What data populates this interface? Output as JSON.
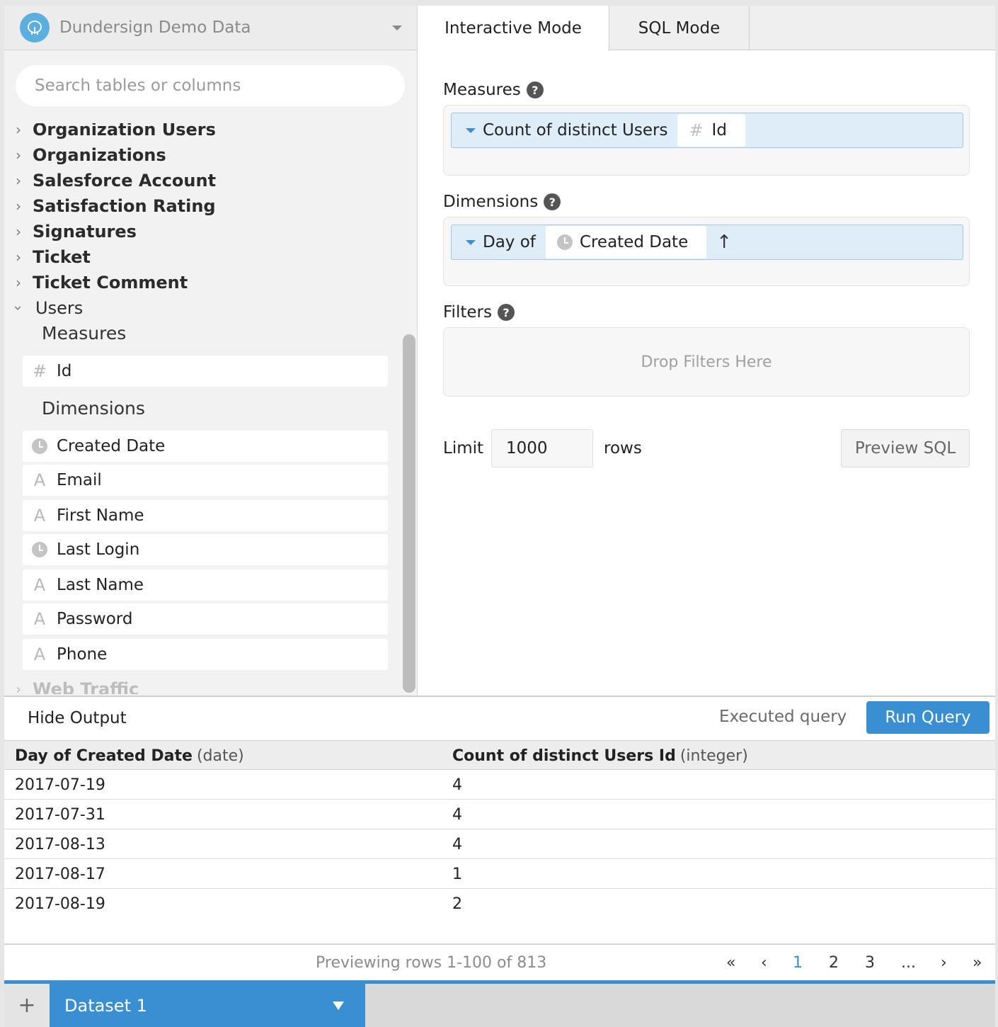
{
  "sidebar": {
    "database": "Dundersign Demo Data",
    "search_placeholder": "Search tables or columns",
    "tables": [
      "Organization Users",
      "Organizations",
      "Salesforce Account",
      "Satisfaction Rating",
      "Signatures",
      "Ticket",
      "Ticket Comment"
    ],
    "open_table": "Users",
    "measures_label": "Measures",
    "measures": [
      "Id"
    ],
    "dimensions_label": "Dimensions",
    "dimensions": [
      {
        "label": "Created Date",
        "type": "date"
      },
      {
        "label": "Email",
        "type": "text"
      },
      {
        "label": "First Name",
        "type": "text"
      },
      {
        "label": "Last Login",
        "type": "date"
      },
      {
        "label": "Last Name",
        "type": "text"
      },
      {
        "label": "Password",
        "type": "text"
      },
      {
        "label": "Phone",
        "type": "text"
      }
    ],
    "faded_table": "Web Traffic"
  },
  "tabs": {
    "interactive": "Interactive Mode",
    "sql": "SQL Mode"
  },
  "builder": {
    "measures_label": "Measures",
    "measure_agg": "Count of distinct Users",
    "measure_field": "Id",
    "dimensions_label": "Dimensions",
    "dimension_agg": "Day of",
    "dimension_field": "Created Date",
    "dimension_sort": "↑",
    "filters_label": "Filters",
    "filters_placeholder": "Drop Filters Here",
    "limit_label": "Limit",
    "limit_value": "1000",
    "rows_label": "rows",
    "preview_sql": "Preview SQL"
  },
  "output": {
    "hide_output": "Hide Output",
    "status": "Executed query",
    "run_query": "Run Query",
    "columns": [
      {
        "name": "Day of Created Date",
        "type": "(date)"
      },
      {
        "name": "Count of distinct Users Id",
        "type": "(integer)"
      }
    ],
    "rows": [
      [
        "2017-07-19",
        "4"
      ],
      [
        "2017-07-31",
        "4"
      ],
      [
        "2017-08-13",
        "4"
      ],
      [
        "2017-08-17",
        "1"
      ],
      [
        "2017-08-19",
        "2"
      ]
    ],
    "pagination": {
      "summary": "Previewing rows 1-100 of 813",
      "first": "«",
      "prev": "‹",
      "pages": [
        "1",
        "2",
        "3"
      ],
      "current": "1",
      "ellipsis": "...",
      "next": "›",
      "last": "»"
    }
  },
  "datasets": {
    "add": "+",
    "active": "Dataset 1"
  },
  "colors": {
    "accent": "#3a8fd2",
    "pill_bg": "#dfedf8",
    "sidebar_bg": "#f2f2f2"
  }
}
